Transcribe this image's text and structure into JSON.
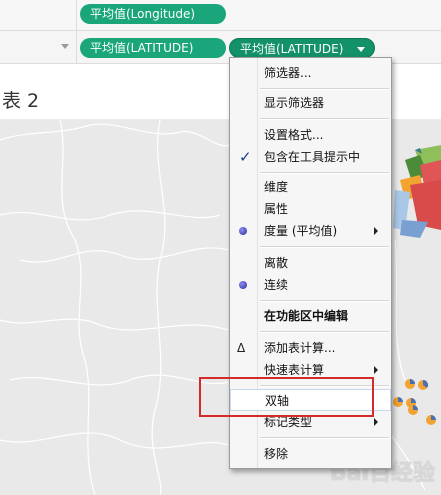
{
  "shelves": {
    "columns": {
      "pills": [
        "平均值(Longitude)"
      ]
    },
    "rows": {
      "pills": [
        "平均值(LATITUDE)",
        "平均值(LATITUDE)"
      ]
    }
  },
  "sheet": {
    "title": "表 2"
  },
  "context_menu": {
    "items": [
      {
        "label": "筛选器..."
      },
      {
        "label": "显示筛选器"
      },
      {
        "label": "设置格式..."
      },
      {
        "label": "包含在工具提示中",
        "checked": true
      },
      {
        "label": "维度"
      },
      {
        "label": "属性"
      },
      {
        "label": "度量 (平均值)",
        "selected": true,
        "submenu": true
      },
      {
        "label": "离散"
      },
      {
        "label": "连续",
        "selected": true
      },
      {
        "label": "在功能区中编辑"
      },
      {
        "label": "添加表计算..."
      },
      {
        "label": "快速表计算",
        "submenu": true
      },
      {
        "label": "双轴",
        "hovered": true,
        "highlighted": true
      },
      {
        "label": "标记类型",
        "submenu": true
      },
      {
        "label": "移除"
      }
    ]
  },
  "watermark": {
    "text": "Bai百经验"
  },
  "colors": {
    "pill": "#1aa67a",
    "highlight": "#d42a2a",
    "map_bg": "#e9e9e9"
  }
}
